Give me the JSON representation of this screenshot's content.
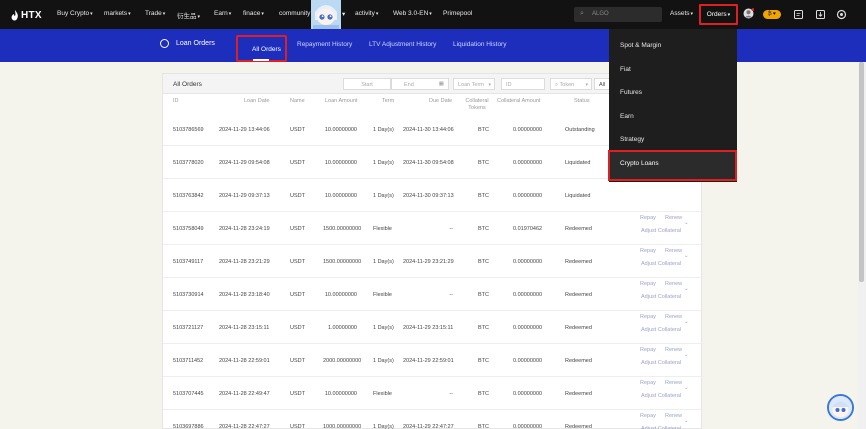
{
  "nav": {
    "logo": "HTX",
    "items": [
      {
        "label": "Buy Crypto",
        "caret": true
      },
      {
        "label": "markets",
        "caret": true
      },
      {
        "label": "Trade",
        "caret": true
      },
      {
        "label": "衍生品",
        "caret": true
      },
      {
        "label": "Earn",
        "caret": true
      },
      {
        "label": "finace",
        "caret": true
      },
      {
        "label": "community",
        "caret": false
      },
      {
        "label": "activity",
        "caret": true
      },
      {
        "label": "Web 3.0-EN",
        "caret": true
      },
      {
        "label": "Primepool",
        "caret": false
      }
    ],
    "search_placeholder": "ALGO",
    "assets": "Assets",
    "orders": "Orders",
    "badge": "₿ ♥"
  },
  "subnav": {
    "title": "Loan Orders",
    "tabs": [
      "All Orders",
      "Repayment History",
      "LTV Adjustment History",
      "Liquidation History"
    ]
  },
  "panel": {
    "title": "All Orders",
    "filters": {
      "start": "Start",
      "end": "End",
      "loan_term": "Loan Term",
      "id": "ID",
      "token": "Token",
      "all": "All"
    },
    "headers": [
      "ID",
      "Loan Date",
      "Name",
      "Loan Amount",
      "Term",
      "Due Date",
      "Collateral Tokens",
      "Collateral Amount",
      "Status"
    ],
    "actions": {
      "repay": "Repay",
      "renew": "Renew",
      "adjust": "Adjust Collateral"
    },
    "rows": [
      {
        "id": "5103786569",
        "loan_date": "2024-11-29 13:44:06",
        "name": "USDT",
        "amount": "10.00000000",
        "term": "1 Day(s)",
        "due": "2024-11-30 13:44:06",
        "coll": "BTC",
        "coll_amount": "0.00000000",
        "status": "Outstanding"
      },
      {
        "id": "5103778020",
        "loan_date": "2024-11-29 09:54:08",
        "name": "USDT",
        "amount": "10.00000000",
        "term": "1 Day(s)",
        "due": "2024-11-30 09:54:08",
        "coll": "BTC",
        "coll_amount": "0.00000000",
        "status": "Liquidated"
      },
      {
        "id": "5103763842",
        "loan_date": "2024-11-29 09:37:13",
        "name": "USDT",
        "amount": "10.00000000",
        "term": "1 Day(s)",
        "due": "2024-11-30 09:37:13",
        "coll": "BTC",
        "coll_amount": "0.00000000",
        "status": "Liquidated"
      },
      {
        "id": "5103758049",
        "loan_date": "2024-11-28 23:24:19",
        "name": "USDT",
        "amount": "1500.00000000",
        "term": "Flexible",
        "due": "--",
        "coll": "BTC",
        "coll_amount": "0.01970462",
        "status": "Redeemed"
      },
      {
        "id": "5103749117",
        "loan_date": "2024-11-28 23:21:29",
        "name": "USDT",
        "amount": "1500.00000000",
        "term": "1 Day(s)",
        "due": "2024-11-29 23:21:29",
        "coll": "BTC",
        "coll_amount": "0.00000000",
        "status": "Redeemed"
      },
      {
        "id": "5103730914",
        "loan_date": "2024-11-28 23:18:40",
        "name": "USDT",
        "amount": "10.00000000",
        "term": "Flexible",
        "due": "--",
        "coll": "BTC",
        "coll_amount": "0.00000000",
        "status": "Redeemed"
      },
      {
        "id": "5103721127",
        "loan_date": "2024-11-28 23:15:11",
        "name": "USDT",
        "amount": "1.00000000",
        "term": "1 Day(s)",
        "due": "2024-11-29 23:15:11",
        "coll": "BTC",
        "coll_amount": "0.00000000",
        "status": "Redeemed"
      },
      {
        "id": "5103711452",
        "loan_date": "2024-11-28 22:59:01",
        "name": "USDT",
        "amount": "2000.00000000",
        "term": "1 Day(s)",
        "due": "2024-11-29 22:59:01",
        "coll": "BTC",
        "coll_amount": "0.00000000",
        "status": "Redeemed"
      },
      {
        "id": "5103707445",
        "loan_date": "2024-11-28 22:49:47",
        "name": "USDT",
        "amount": "10.00000000",
        "term": "Flexible",
        "due": "--",
        "coll": "BTC",
        "coll_amount": "0.00000000",
        "status": "Redeemed"
      },
      {
        "id": "5103697886",
        "loan_date": "2024-11-28 22:47:27",
        "name": "USDT",
        "amount": "1000.00000000",
        "term": "1 Day(s)",
        "due": "2024-11-29 22:47:27",
        "coll": "BTC",
        "coll_amount": "0.00000000",
        "status": "Redeemed"
      }
    ]
  },
  "dropdown": {
    "items": [
      "Spot & Margin",
      "Fiat",
      "Futures",
      "Earn",
      "Strategy",
      "Crypto Loans"
    ]
  }
}
